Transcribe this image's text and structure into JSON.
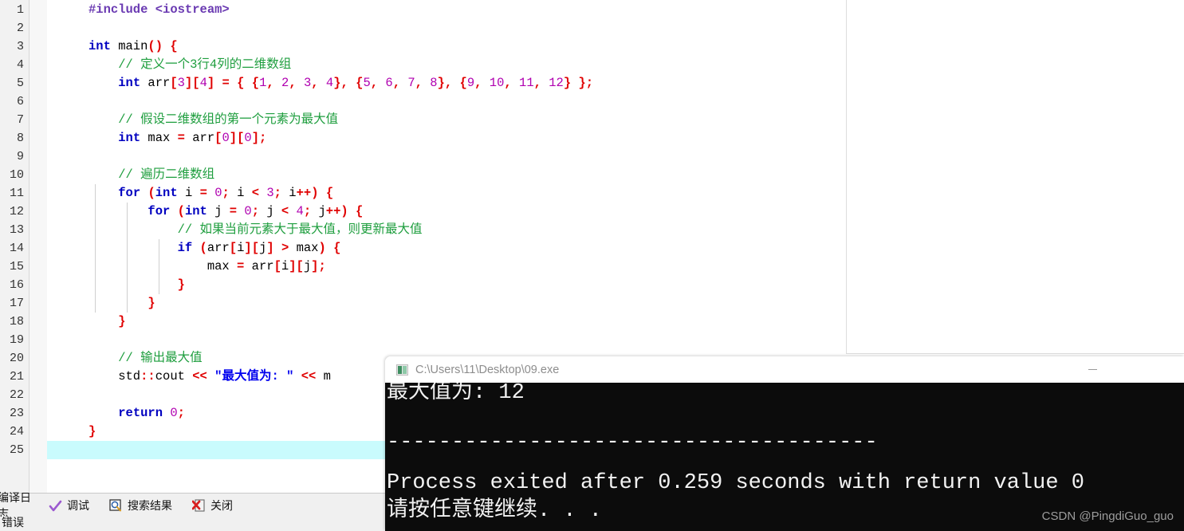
{
  "editor": {
    "lines": [
      {
        "n": 1,
        "fold": "none",
        "tokens": [
          {
            "t": "#include ",
            "c": "pp"
          },
          {
            "t": "<iostream>",
            "c": "hdr"
          }
        ]
      },
      {
        "n": 2,
        "fold": "none",
        "tokens": []
      },
      {
        "n": 3,
        "fold": "open",
        "tokens": [
          {
            "t": "int",
            "c": "kw"
          },
          {
            "t": " main",
            "c": "pl"
          },
          {
            "t": "()",
            "c": "br"
          },
          {
            "t": " ",
            "c": "pl"
          },
          {
            "t": "{",
            "c": "br"
          }
        ]
      },
      {
        "n": 4,
        "fold": "line",
        "tokens": [
          {
            "t": "    // 定义一个3行4列的二维数组",
            "c": "cm"
          }
        ]
      },
      {
        "n": 5,
        "fold": "line",
        "tokens": [
          {
            "t": "    ",
            "c": "pl"
          },
          {
            "t": "int",
            "c": "kw"
          },
          {
            "t": " arr",
            "c": "pl"
          },
          {
            "t": "[",
            "c": "br"
          },
          {
            "t": "3",
            "c": "num"
          },
          {
            "t": "]",
            "c": "br"
          },
          {
            "t": "[",
            "c": "br"
          },
          {
            "t": "4",
            "c": "num"
          },
          {
            "t": "]",
            "c": "br"
          },
          {
            "t": " ",
            "c": "pl"
          },
          {
            "t": "=",
            "c": "op"
          },
          {
            "t": " ",
            "c": "pl"
          },
          {
            "t": "{",
            "c": "br"
          },
          {
            "t": " ",
            "c": "pl"
          },
          {
            "t": "{",
            "c": "br"
          },
          {
            "t": "1",
            "c": "num"
          },
          {
            "t": ",",
            "c": "sep"
          },
          {
            "t": " ",
            "c": "pl"
          },
          {
            "t": "2",
            "c": "num"
          },
          {
            "t": ",",
            "c": "sep"
          },
          {
            "t": " ",
            "c": "pl"
          },
          {
            "t": "3",
            "c": "num"
          },
          {
            "t": ",",
            "c": "sep"
          },
          {
            "t": " ",
            "c": "pl"
          },
          {
            "t": "4",
            "c": "num"
          },
          {
            "t": "}",
            "c": "br"
          },
          {
            "t": ",",
            "c": "sep"
          },
          {
            "t": " ",
            "c": "pl"
          },
          {
            "t": "{",
            "c": "br"
          },
          {
            "t": "5",
            "c": "num"
          },
          {
            "t": ",",
            "c": "sep"
          },
          {
            "t": " ",
            "c": "pl"
          },
          {
            "t": "6",
            "c": "num"
          },
          {
            "t": ",",
            "c": "sep"
          },
          {
            "t": " ",
            "c": "pl"
          },
          {
            "t": "7",
            "c": "num"
          },
          {
            "t": ",",
            "c": "sep"
          },
          {
            "t": " ",
            "c": "pl"
          },
          {
            "t": "8",
            "c": "num"
          },
          {
            "t": "}",
            "c": "br"
          },
          {
            "t": ",",
            "c": "sep"
          },
          {
            "t": " ",
            "c": "pl"
          },
          {
            "t": "{",
            "c": "br"
          },
          {
            "t": "9",
            "c": "num"
          },
          {
            "t": ",",
            "c": "sep"
          },
          {
            "t": " ",
            "c": "pl"
          },
          {
            "t": "10",
            "c": "num"
          },
          {
            "t": ",",
            "c": "sep"
          },
          {
            "t": " ",
            "c": "pl"
          },
          {
            "t": "11",
            "c": "num"
          },
          {
            "t": ",",
            "c": "sep"
          },
          {
            "t": " ",
            "c": "pl"
          },
          {
            "t": "12",
            "c": "num"
          },
          {
            "t": "}",
            "c": "br"
          },
          {
            "t": " ",
            "c": "pl"
          },
          {
            "t": "}",
            "c": "br"
          },
          {
            "t": ";",
            "c": "sep"
          }
        ]
      },
      {
        "n": 6,
        "fold": "line",
        "tokens": []
      },
      {
        "n": 7,
        "fold": "line",
        "tokens": [
          {
            "t": "    // 假设二维数组的第一个元素为最大值",
            "c": "cm"
          }
        ]
      },
      {
        "n": 8,
        "fold": "line",
        "tokens": [
          {
            "t": "    ",
            "c": "pl"
          },
          {
            "t": "int",
            "c": "kw"
          },
          {
            "t": " max ",
            "c": "pl"
          },
          {
            "t": "=",
            "c": "op"
          },
          {
            "t": " arr",
            "c": "pl"
          },
          {
            "t": "[",
            "c": "br"
          },
          {
            "t": "0",
            "c": "num"
          },
          {
            "t": "]",
            "c": "br"
          },
          {
            "t": "[",
            "c": "br"
          },
          {
            "t": "0",
            "c": "num"
          },
          {
            "t": "]",
            "c": "br"
          },
          {
            "t": ";",
            "c": "sep"
          }
        ]
      },
      {
        "n": 9,
        "fold": "line",
        "tokens": []
      },
      {
        "n": 10,
        "fold": "line",
        "tokens": [
          {
            "t": "    // 遍历二维数组",
            "c": "cm"
          }
        ]
      },
      {
        "n": 11,
        "fold": "open",
        "tokens": [
          {
            "t": "    ",
            "c": "pl"
          },
          {
            "t": "for",
            "c": "kw"
          },
          {
            "t": " ",
            "c": "pl"
          },
          {
            "t": "(",
            "c": "br"
          },
          {
            "t": "int",
            "c": "kw"
          },
          {
            "t": " i ",
            "c": "pl"
          },
          {
            "t": "=",
            "c": "op"
          },
          {
            "t": " ",
            "c": "pl"
          },
          {
            "t": "0",
            "c": "num"
          },
          {
            "t": ";",
            "c": "sep"
          },
          {
            "t": " i ",
            "c": "pl"
          },
          {
            "t": "<",
            "c": "op"
          },
          {
            "t": " ",
            "c": "pl"
          },
          {
            "t": "3",
            "c": "num"
          },
          {
            "t": ";",
            "c": "sep"
          },
          {
            "t": " i",
            "c": "pl"
          },
          {
            "t": "++",
            "c": "op"
          },
          {
            "t": ")",
            "c": "br"
          },
          {
            "t": " ",
            "c": "pl"
          },
          {
            "t": "{",
            "c": "br"
          }
        ]
      },
      {
        "n": 12,
        "fold": "open",
        "tokens": [
          {
            "t": "        ",
            "c": "pl"
          },
          {
            "t": "for",
            "c": "kw"
          },
          {
            "t": " ",
            "c": "pl"
          },
          {
            "t": "(",
            "c": "br"
          },
          {
            "t": "int",
            "c": "kw"
          },
          {
            "t": " j ",
            "c": "pl"
          },
          {
            "t": "=",
            "c": "op"
          },
          {
            "t": " ",
            "c": "pl"
          },
          {
            "t": "0",
            "c": "num"
          },
          {
            "t": ";",
            "c": "sep"
          },
          {
            "t": " j ",
            "c": "pl"
          },
          {
            "t": "<",
            "c": "op"
          },
          {
            "t": " ",
            "c": "pl"
          },
          {
            "t": "4",
            "c": "num"
          },
          {
            "t": ";",
            "c": "sep"
          },
          {
            "t": " j",
            "c": "pl"
          },
          {
            "t": "++",
            "c": "op"
          },
          {
            "t": ")",
            "c": "br"
          },
          {
            "t": " ",
            "c": "pl"
          },
          {
            "t": "{",
            "c": "br"
          }
        ]
      },
      {
        "n": 13,
        "fold": "line",
        "tokens": [
          {
            "t": "            // 如果当前元素大于最大值，则更新最大值",
            "c": "cm"
          }
        ]
      },
      {
        "n": 14,
        "fold": "open",
        "tokens": [
          {
            "t": "            ",
            "c": "pl"
          },
          {
            "t": "if",
            "c": "kw"
          },
          {
            "t": " ",
            "c": "pl"
          },
          {
            "t": "(",
            "c": "br"
          },
          {
            "t": "arr",
            "c": "pl"
          },
          {
            "t": "[",
            "c": "br"
          },
          {
            "t": "i",
            "c": "pl"
          },
          {
            "t": "]",
            "c": "br"
          },
          {
            "t": "[",
            "c": "br"
          },
          {
            "t": "j",
            "c": "pl"
          },
          {
            "t": "]",
            "c": "br"
          },
          {
            "t": " ",
            "c": "pl"
          },
          {
            "t": ">",
            "c": "op"
          },
          {
            "t": " max",
            "c": "pl"
          },
          {
            "t": ")",
            "c": "br"
          },
          {
            "t": " ",
            "c": "pl"
          },
          {
            "t": "{",
            "c": "br"
          }
        ]
      },
      {
        "n": 15,
        "fold": "line",
        "tokens": [
          {
            "t": "                max ",
            "c": "pl"
          },
          {
            "t": "=",
            "c": "op"
          },
          {
            "t": " arr",
            "c": "pl"
          },
          {
            "t": "[",
            "c": "br"
          },
          {
            "t": "i",
            "c": "pl"
          },
          {
            "t": "]",
            "c": "br"
          },
          {
            "t": "[",
            "c": "br"
          },
          {
            "t": "j",
            "c": "pl"
          },
          {
            "t": "]",
            "c": "br"
          },
          {
            "t": ";",
            "c": "sep"
          }
        ]
      },
      {
        "n": 16,
        "fold": "end",
        "tokens": [
          {
            "t": "            ",
            "c": "pl"
          },
          {
            "t": "}",
            "c": "br"
          }
        ]
      },
      {
        "n": 17,
        "fold": "end",
        "tokens": [
          {
            "t": "        ",
            "c": "pl"
          },
          {
            "t": "}",
            "c": "br"
          }
        ]
      },
      {
        "n": 18,
        "fold": "end",
        "tokens": [
          {
            "t": "    ",
            "c": "pl"
          },
          {
            "t": "}",
            "c": "br"
          }
        ]
      },
      {
        "n": 19,
        "fold": "line",
        "tokens": []
      },
      {
        "n": 20,
        "fold": "line",
        "tokens": [
          {
            "t": "    // 输出最大值",
            "c": "cm"
          }
        ]
      },
      {
        "n": 21,
        "fold": "line",
        "tokens": [
          {
            "t": "    std",
            "c": "pl"
          },
          {
            "t": "::",
            "c": "sep"
          },
          {
            "t": "cout ",
            "c": "pl"
          },
          {
            "t": "<<",
            "c": "op"
          },
          {
            "t": " ",
            "c": "pl"
          },
          {
            "t": "\"最大值为: \"",
            "c": "str"
          },
          {
            "t": " ",
            "c": "pl"
          },
          {
            "t": "<<",
            "c": "op"
          },
          {
            "t": " m",
            "c": "pl"
          }
        ]
      },
      {
        "n": 22,
        "fold": "line",
        "tokens": []
      },
      {
        "n": 23,
        "fold": "line",
        "tokens": [
          {
            "t": "    ",
            "c": "pl"
          },
          {
            "t": "return",
            "c": "kw"
          },
          {
            "t": " ",
            "c": "pl"
          },
          {
            "t": "0",
            "c": "num"
          },
          {
            "t": ";",
            "c": "sep"
          }
        ]
      },
      {
        "n": 24,
        "fold": "close",
        "tokens": [
          {
            "t": "}",
            "c": "br"
          }
        ]
      },
      {
        "n": 25,
        "fold": "none",
        "tokens": [],
        "highlight": true
      }
    ],
    "caret_line": 25
  },
  "tabs": {
    "items": [
      {
        "label": "编译日志",
        "icon": "none",
        "state": "cut"
      },
      {
        "label": "调试",
        "icon": "check-icon",
        "state": "normal"
      },
      {
        "label": "搜索结果",
        "icon": "search-icon",
        "state": "normal"
      },
      {
        "label": "关闭",
        "icon": "close-icon",
        "state": "normal"
      }
    ],
    "bottom_label": "错误"
  },
  "console": {
    "title": "C:\\Users\\11\\Desktop\\09.exe",
    "minimize_label": "—",
    "lines": [
      "最大值为: 12",
      "",
      "--------------------------------",
      "Process exited after 0.259 seconds with return value 0",
      "请按任意键继续. . ."
    ],
    "watermark": "CSDN @PingdiGuo_guo"
  },
  "colors": {
    "keyword": "#0000c0",
    "comment": "#1e9e3e",
    "number": "#b000b0",
    "bracket": "#e00000",
    "string": "#0000ee",
    "preproc": "#6a3ab2",
    "caret_line_bg": "#c9fbfd",
    "console_bg": "#0c0c0c",
    "gutter_bg": "#f2f2f2"
  }
}
